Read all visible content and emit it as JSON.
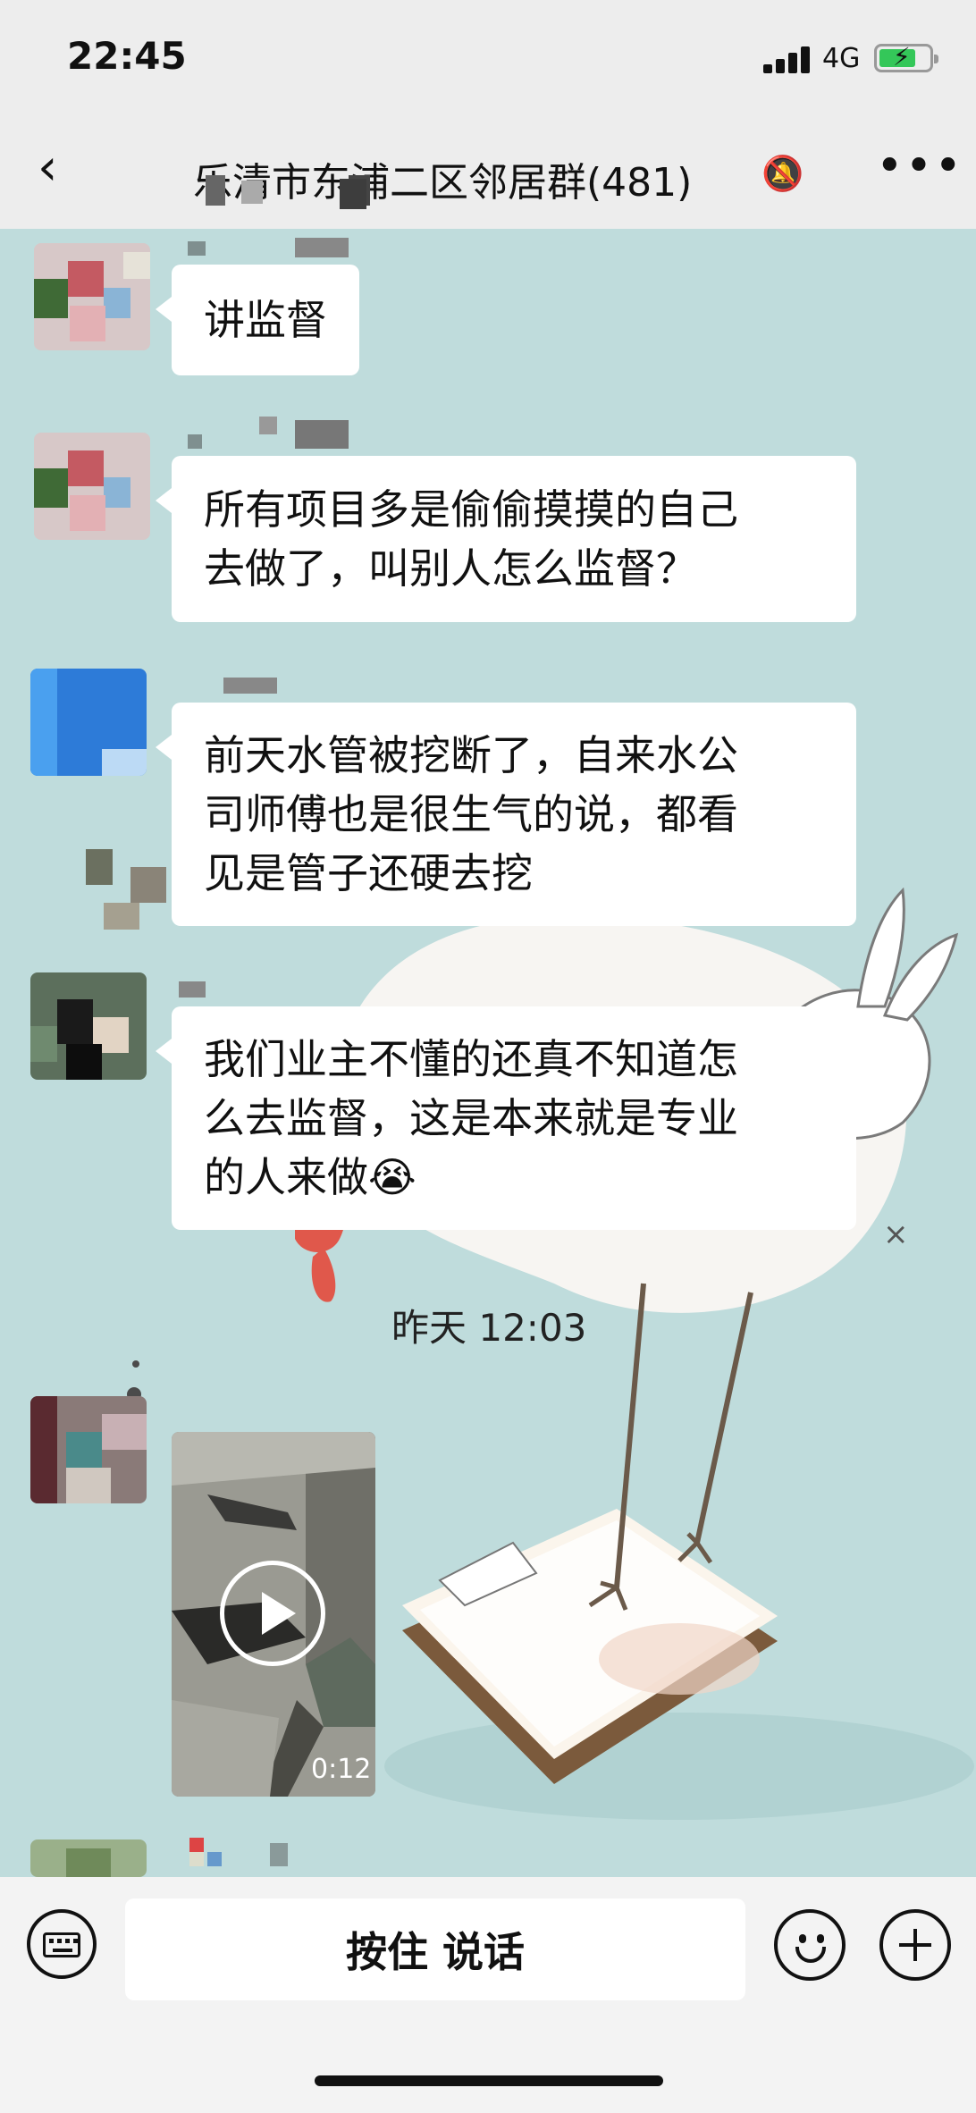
{
  "status_bar": {
    "time": "22:45",
    "network": "4G"
  },
  "header": {
    "title": "乐清市东浦二区邻居群(481)",
    "back_icon": "chevron-left-icon",
    "mute_icon": "bell-off-icon",
    "more_icon": "ellipsis-icon"
  },
  "messages": [
    {
      "lines": [
        "讲监督"
      ]
    },
    {
      "lines": [
        "所有项目多是偷偷摸摸的自己",
        "去做了，叫别人怎么监督？"
      ]
    },
    {
      "lines": [
        "前天水管被挖断了，自来水公",
        "司师傅也是很生气的说，都看",
        "见是管子还硬去挖"
      ]
    },
    {
      "lines": [
        "我们业主不懂的还真不知道怎",
        "么去监督，这是本来就是专业",
        "的人来做😭"
      ]
    }
  ],
  "timestamp": "昨天 12:03",
  "video": {
    "duration": "0:12"
  },
  "input_bar": {
    "voice_label": "按住 说话",
    "keyboard_icon": "keyboard-icon",
    "emoji_icon": "smile-icon",
    "plus_icon": "plus-icon"
  },
  "colors": {
    "chat_background": "#bfdcdc",
    "bubble": "#ffffff",
    "bar": "#ededed",
    "battery": "#34c759"
  }
}
